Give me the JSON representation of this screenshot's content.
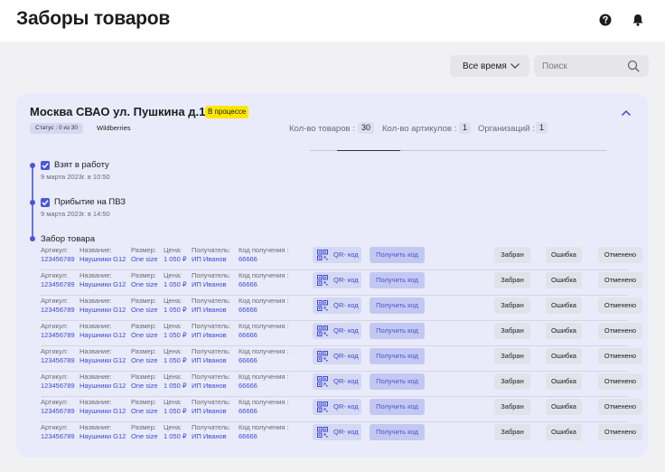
{
  "header": {
    "title": "Заборы товаров",
    "help_icon": "help-circle-icon",
    "bell_icon": "bell-icon"
  },
  "filters": {
    "period": "Все время",
    "search_placeholder": "Поиск"
  },
  "order": {
    "address": "Москва СВАО ул. Пушкина д.12",
    "status": "В процессе",
    "status_chip": "Статус : 0 из 30",
    "marketplace": "Wildberries",
    "stats": [
      {
        "label": "Кол-во товаров :",
        "value": "30"
      },
      {
        "label": "Кол-во артикулов :",
        "value": "1"
      },
      {
        "label": "Организаций :",
        "value": "1"
      }
    ],
    "steps": [
      {
        "title": "Взят в работу",
        "date": "9 марта 2023г. в 10:50"
      },
      {
        "title": "Прибытие на ПВЗ",
        "date": "9 марта 2023г. в 14:50"
      },
      {
        "title": "Забор товара"
      }
    ]
  },
  "columns": {
    "article": "Артикул:",
    "name": "Название:",
    "size": "Размер:",
    "price": "Цена:",
    "recipient": "Получатель:",
    "code": "Код получения :"
  },
  "buttons": {
    "qr": "QR- код",
    "get_code": "Получить код",
    "taken": "Забран",
    "error": "Ошибка",
    "cancelled": "Отменено"
  },
  "items": [
    {
      "article": "123456789",
      "name": "Наушники G12",
      "size": "One size",
      "price": "1 050 ₽",
      "recipient": "ИП Иванов",
      "code": "66666"
    },
    {
      "article": "123456789",
      "name": "Наушники G12",
      "size": "One size",
      "price": "1 050 ₽",
      "recipient": "ИП Иванов",
      "code": "66666"
    },
    {
      "article": "123456789",
      "name": "Наушники G12",
      "size": "One size",
      "price": "1 050 ₽",
      "recipient": "ИП Иванов",
      "code": "66666"
    },
    {
      "article": "123456789",
      "name": "Наушники G12",
      "size": "One size",
      "price": "1 050 ₽",
      "recipient": "ИП Иванов",
      "code": "66666"
    },
    {
      "article": "123456789",
      "name": "Наушники G12",
      "size": "One size",
      "price": "1 050 ₽",
      "recipient": "ИП Иванов",
      "code": "66666"
    },
    {
      "article": "123456789",
      "name": "Наушники G12",
      "size": "One size",
      "price": "1 050 ₽",
      "recipient": "ИП Иванов",
      "code": "66666"
    },
    {
      "article": "123456789",
      "name": "Наушники G12",
      "size": "One size",
      "price": "1 050 ₽",
      "recipient": "ИП Иванов",
      "code": "66666"
    },
    {
      "article": "123456789",
      "name": "Наушники G12",
      "size": "One size",
      "price": "1 050 ₽",
      "recipient": "ИП Иванов",
      "code": "66666"
    }
  ]
}
